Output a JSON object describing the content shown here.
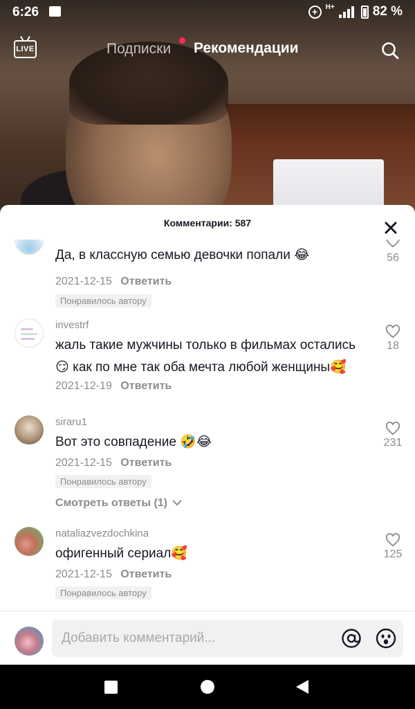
{
  "status_bar": {
    "time": "6:26",
    "network": "H+",
    "battery": "82 %"
  },
  "top_nav": {
    "live_label": "LIVE",
    "tab_following": "Подписки",
    "tab_for_you": "Рекомендации",
    "accent_color": "#fe2c55"
  },
  "comments_sheet": {
    "title": "Комментарии: 587",
    "comments": [
      {
        "username": "",
        "text": "Да, в классную семью девочки попали 😂",
        "date": "2021-12-15",
        "reply_label": "Ответить",
        "liked_by_author": "Понравилось автору",
        "likes": "56"
      },
      {
        "username": "investrf",
        "text": "жаль такие мужчины только в фильмах остались 😏 как по мне так оба мечта любой женщины🥰",
        "date": "2021-12-19",
        "reply_label": "Ответить",
        "likes": "18"
      },
      {
        "username": "siraru1",
        "text": "Вот это совпадение 🤣😂",
        "date": "2021-12-15",
        "reply_label": "Ответить",
        "liked_by_author": "Понравилось автору",
        "view_replies": "Смотреть ответы (1)",
        "likes": "231"
      },
      {
        "username": "nataliazvezdochkina",
        "text": "офигенный сериал🥰",
        "date": "2021-12-15",
        "reply_label": "Ответить",
        "liked_by_author": "Понравилось автору",
        "likes": "125"
      }
    ]
  },
  "input_bar": {
    "placeholder": "Добавить комментарий...",
    "value": ""
  }
}
